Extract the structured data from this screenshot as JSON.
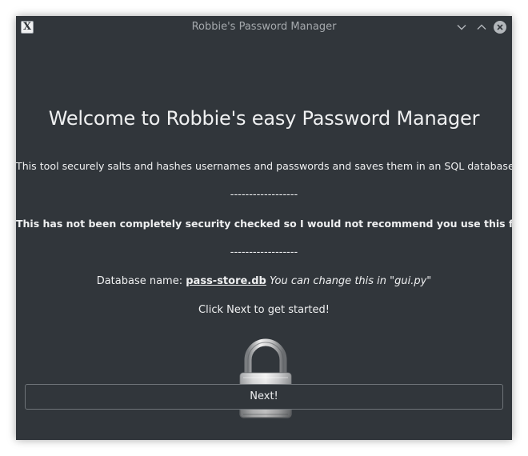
{
  "window": {
    "title": "Robbie's Password Manager",
    "app_icon_glyph": "X"
  },
  "titlebar_buttons": {
    "minimize_icon": "chevron-down-icon",
    "maximize_icon": "chevron-up-icon",
    "close_icon": "close-icon"
  },
  "main": {
    "heading": "Welcome to Robbie's easy Password Manager",
    "description": "This tool securely salts and hashes usernames and passwords and saves them in an SQL database.",
    "separator_1": "------------------",
    "warning": "This has not been completely security checked so I would not recommend you use this for BAU.",
    "separator_2": "------------------",
    "database_label": "Database name:",
    "database_name": "pass-store.db",
    "database_hint": "You can change this in \"gui.py\"",
    "call_to_action": "Click Next to get started!",
    "lock_image": "padlock-icon"
  },
  "footer": {
    "next_label": "Next!"
  },
  "colors": {
    "background": "#31363b",
    "text": "#eff0f1",
    "title_text": "#a5a9ad",
    "button_border": "#6e7378"
  }
}
